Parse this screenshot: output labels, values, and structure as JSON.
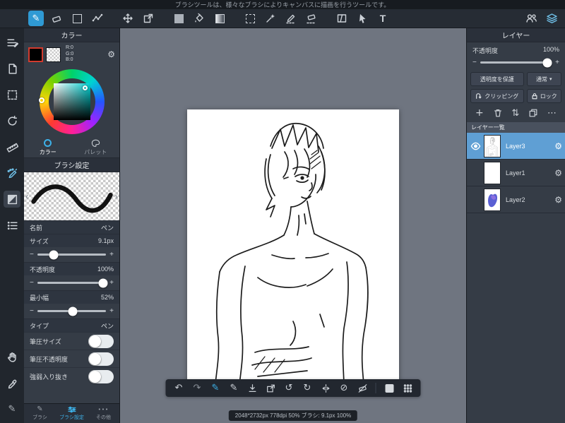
{
  "colors": {
    "accent": "#2f9ad4",
    "selected_layer": "#5f9fd4",
    "canvas_bg": "#6f7580",
    "swatch_border": "#d23b2e"
  },
  "tooltip_bar": {
    "text": "ブラシツールは、様々なブラシによりキャンバスに描画を行うツールです。"
  },
  "glyphs": {
    "minus": "−",
    "plus": "+",
    "text_tool": "T",
    "undo": "↶",
    "redo": "↷",
    "rotate_left": "↺",
    "rotate_right": "↻",
    "no_entry": "⊘",
    "gear": "⚙",
    "ellipsis": "⋯",
    "swap": "⇅",
    "caret_down": "▾",
    "chevron_left": "‹",
    "chevron_right": "›",
    "pen": "✎",
    "dots": "•••"
  },
  "color_panel": {
    "title": "カラー",
    "rgb": [
      "R:0",
      "G:0",
      "B:0"
    ],
    "tabs": [
      {
        "label": "カラー"
      },
      {
        "label": "パレット"
      }
    ]
  },
  "brush_panel": {
    "title": "ブラシ設定",
    "rows": {
      "name_label": "名前",
      "name_value": "ペン",
      "size_label": "サイズ",
      "size_value": "9.1px",
      "opacity_label": "不透明度",
      "opacity_value": "100%",
      "minwidth_label": "最小幅",
      "minwidth_value": "52%",
      "type_label": "タイプ",
      "type_value": "ペン"
    },
    "toggles": [
      {
        "label": "筆圧サイズ",
        "state": "off"
      },
      {
        "label": "筆圧不透明度",
        "state": "off"
      },
      {
        "label": "強弱入り抜き",
        "state": "off"
      }
    ]
  },
  "panel_tabs": [
    {
      "label": "ブラシ"
    },
    {
      "label": "ブラシ設定"
    },
    {
      "label": "その他"
    }
  ],
  "layer_panel": {
    "title": "レイヤー",
    "opacity_label": "不透明度",
    "opacity_value": "100%",
    "buttons": {
      "protect": "透明度を保護",
      "blend": "通常",
      "clipping": "クリッピング",
      "lock": "ロック"
    },
    "list_label": "レイヤー一覧",
    "layers": [
      {
        "name": "Layer3",
        "selected": true,
        "visible": true
      },
      {
        "name": "Layer1",
        "selected": false,
        "visible": false
      },
      {
        "name": "Layer2",
        "selected": false,
        "visible": false
      }
    ]
  },
  "status_bar": {
    "text": "2048*2732px 778dpi 50%  ブラシ: 9.1px 100%"
  }
}
